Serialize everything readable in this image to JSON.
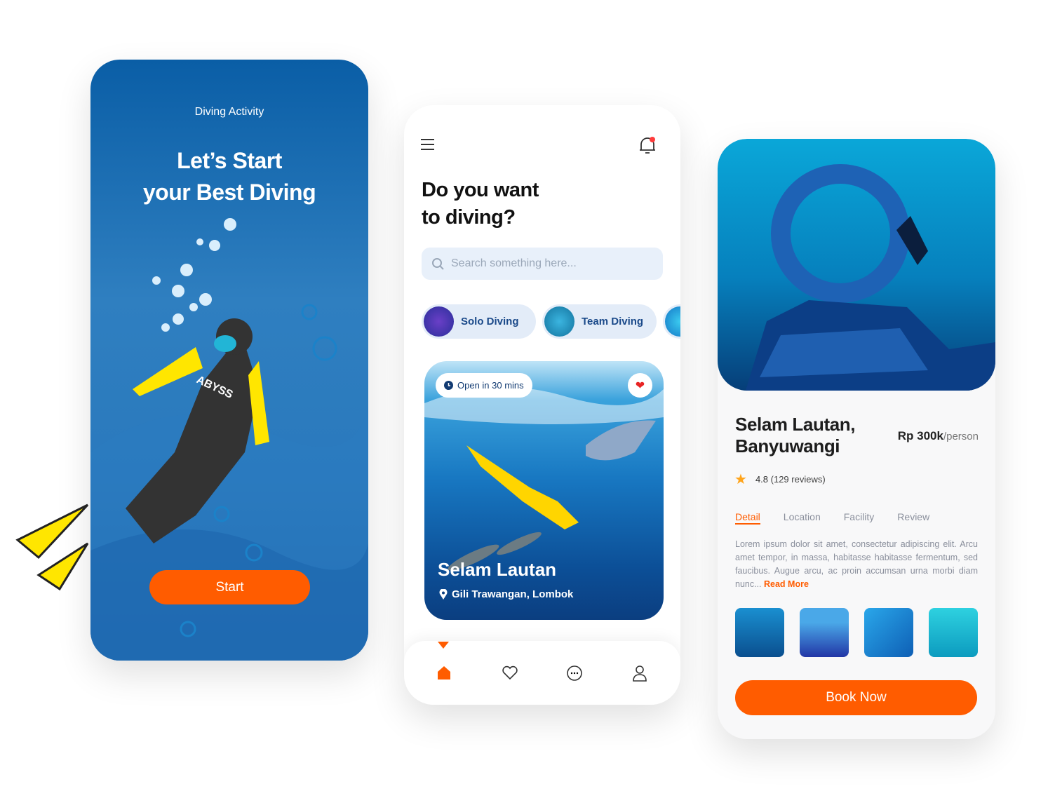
{
  "onboarding": {
    "subtitle": "Diving Activity",
    "title_line1": "Let’s Start",
    "title_line2": "your Best Diving",
    "start_label": "Start",
    "suit_text": "ABYSS"
  },
  "home": {
    "question_line1": "Do you want",
    "question_line2": "to diving?",
    "search_placeholder": "Search something here...",
    "categories": [
      {
        "label": "Solo Diving"
      },
      {
        "label": "Team Diving"
      }
    ],
    "card": {
      "status": "Open in 30 mins",
      "name": "Selam Lautan",
      "location": "Gili Trawangan, Lombok",
      "favorited": true
    },
    "nav": {
      "active": "home",
      "items": [
        "home",
        "favorites",
        "messages",
        "profile"
      ]
    }
  },
  "detail": {
    "name_line1": "Selam Lautan,",
    "name_line2": "Banyuwangi",
    "price": "Rp 300k",
    "price_unit": "/person",
    "rating": "4.8",
    "reviews": "(129 reviews)",
    "tabs": [
      "Detail",
      "Location",
      "Facility",
      "Review"
    ],
    "active_tab": "Detail",
    "description": "Lorem ipsum dolor sit amet, consectetur adipiscing elit. Arcu amet tempor, in massa, habitasse habitasse fermentum, sed faucibus. Augue arcu, ac proin accumsan urna morbi diam nunc... ",
    "read_more": "Read More",
    "book_label": "Book Now"
  },
  "colors": {
    "accent": "#ff5c00",
    "primary_blue": "#1b4a8a"
  }
}
